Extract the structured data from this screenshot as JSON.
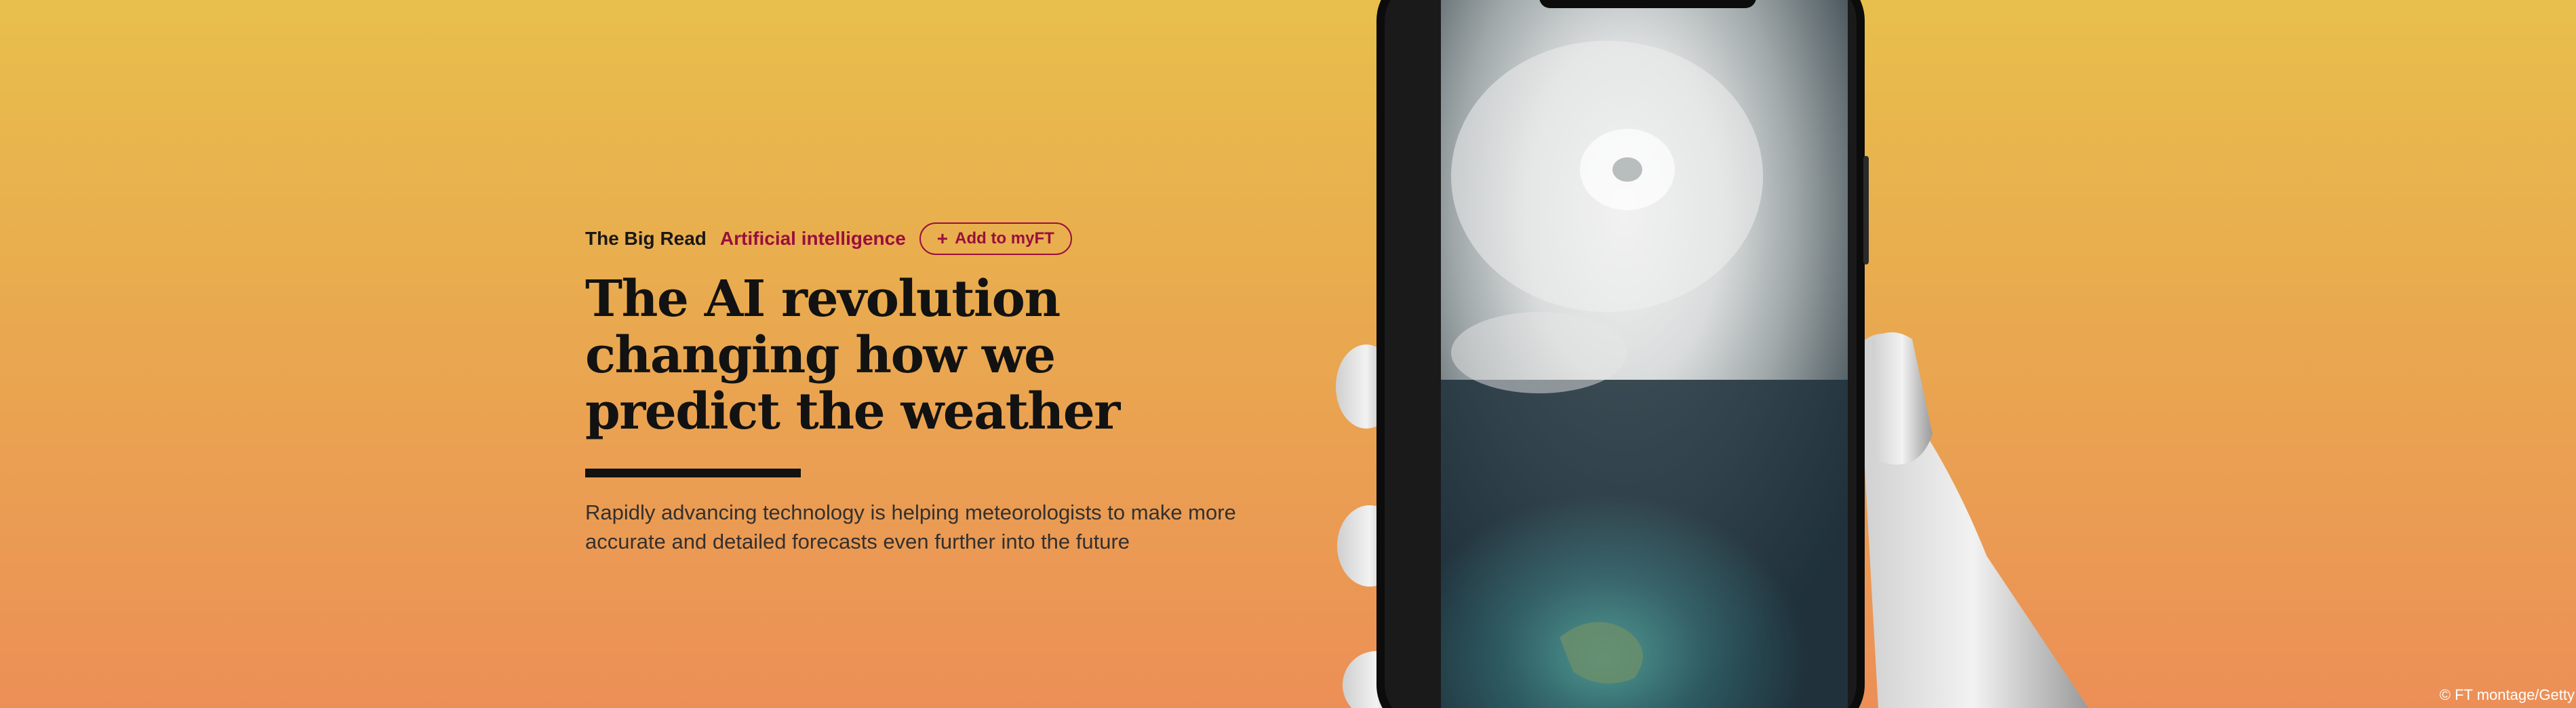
{
  "article": {
    "series": "The Big Read",
    "topic": "Artificial intelligence",
    "myft_label": "Add to myFT",
    "headline": "The AI revolution changing how we predict the weather",
    "standfirst": "Rapidly advancing technology is helping meteorologists to make more accurate and detailed forecasts even further into the future"
  },
  "image": {
    "credit": "© FT montage/Getty"
  },
  "colors": {
    "brand_claret": "#990f3d",
    "text_black": "#121212",
    "gradient_top": "#e8bf4c",
    "gradient_bottom": "#ec8f57"
  }
}
